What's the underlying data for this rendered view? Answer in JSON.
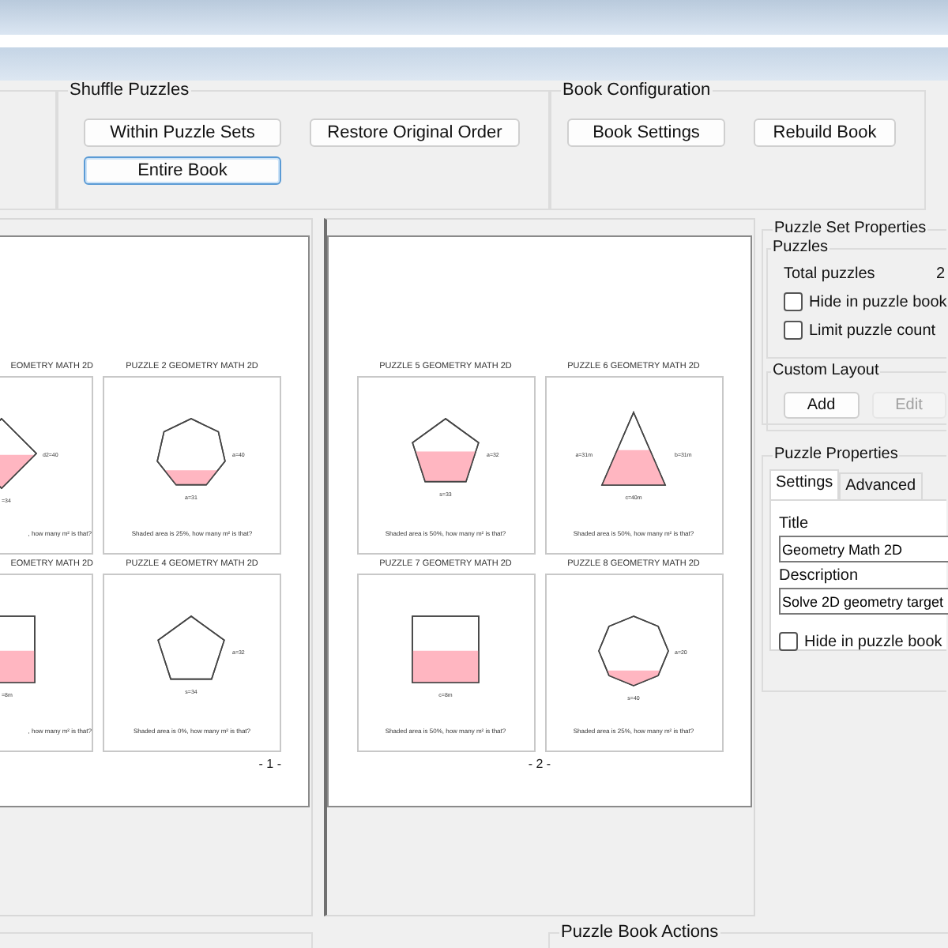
{
  "ribbon": {
    "groups": [
      {
        "title": "Shuffle Puzzles",
        "buttons": [
          {
            "label": "Within Puzzle Sets",
            "focused": false
          },
          {
            "label": "Restore Original Order",
            "focused": false
          },
          {
            "label": "Entire Book",
            "focused": true
          }
        ]
      },
      {
        "title": "Book Configuration",
        "buttons": [
          {
            "label": "Book Settings",
            "focused": false
          },
          {
            "label": "Rebuild Book",
            "focused": false
          }
        ]
      }
    ]
  },
  "pages": [
    {
      "number": "- 1 -",
      "cropped": true,
      "puzzles": [
        {
          "title": "EOMETRY MATH 2D",
          "kind": "diamond",
          "shading": {
            "kind": "half"
          },
          "labels": [
            {
              "text": "d2=40",
              "kind": "right"
            },
            {
              "text": "=34",
              "kind": "bottom"
            }
          ],
          "caption": ", how many m² is that?"
        },
        {
          "title": "PUZZLE 2 GEOMETRY MATH 2D",
          "kind": "heptagon",
          "shading": {
            "kind": "quarter"
          },
          "labels": [
            {
              "text": "a=40",
              "kind": "right"
            },
            {
              "text": "a=31",
              "kind": "bottom"
            }
          ],
          "caption": "Shaded area is 25%, how many m² is that?"
        },
        {
          "title": "EOMETRY MATH 2D",
          "kind": "square",
          "shading": {
            "kind": "half"
          },
          "labels": [
            {
              "text": "=8m",
              "kind": "bottom"
            }
          ],
          "caption": ", how many m² is that?"
        },
        {
          "title": "PUZZLE 4 GEOMETRY MATH 2D",
          "kind": "pentagon",
          "shading": {
            "kind": "none"
          },
          "labels": [
            {
              "text": "a=32",
              "kind": "right"
            },
            {
              "text": "s=34",
              "kind": "bottom"
            }
          ],
          "caption": "Shaded area is 0%, how many m² is that?"
        }
      ]
    },
    {
      "number": "- 2 -",
      "cropped": false,
      "puzzles": [
        {
          "title": "PUZZLE 5 GEOMETRY MATH 2D",
          "kind": "pentagon",
          "shading": {
            "kind": "half"
          },
          "labels": [
            {
              "text": "a=32",
              "kind": "right"
            },
            {
              "text": "s=33",
              "kind": "bottom"
            }
          ],
          "caption": "Shaded area is 50%, how many m² is that?"
        },
        {
          "title": "PUZZLE 6 GEOMETRY MATH 2D",
          "kind": "triangle",
          "shading": {
            "kind": "half"
          },
          "labels": [
            {
              "text": "a=31m",
              "kind": "left"
            },
            {
              "text": "b=31m",
              "kind": "right"
            },
            {
              "text": "c=40m",
              "kind": "bottom"
            }
          ],
          "caption": "Shaded area is 50%, how many m² is that?"
        },
        {
          "title": "PUZZLE 7 GEOMETRY MATH 2D",
          "kind": "square",
          "shading": {
            "kind": "half"
          },
          "labels": [
            {
              "text": "c=8m",
              "kind": "bottom"
            }
          ],
          "caption": "Shaded area is 50%, how many m² is that?"
        },
        {
          "title": "PUZZLE 8 GEOMETRY MATH 2D",
          "kind": "octagon",
          "shading": {
            "kind": "quarter"
          },
          "labels": [
            {
              "text": "a=20",
              "kind": "right"
            },
            {
              "text": "s=40",
              "kind": "bottom"
            }
          ],
          "caption": "Shaded area is 25%, how many m² is that?"
        }
      ]
    }
  ],
  "puzzle_set_properties": {
    "title": "Puzzle Set Properties",
    "puzzles": {
      "title": "Puzzles",
      "total_label": "Total puzzles",
      "total_value": "2",
      "checkboxes": [
        {
          "label": "Hide in puzzle book",
          "checked": false
        },
        {
          "label": "Limit puzzle count",
          "checked": false
        }
      ]
    },
    "custom_layout": {
      "title": "Custom Layout",
      "buttons": [
        {
          "label": "Add",
          "disabled": false
        },
        {
          "label": "Edit",
          "disabled": true
        }
      ]
    }
  },
  "puzzle_properties": {
    "title": "Puzzle Properties",
    "tabs": [
      {
        "label": "Settings",
        "selected": true
      },
      {
        "label": "Advanced",
        "selected": false
      }
    ],
    "fields": [
      {
        "label": "Title",
        "value": "Geometry Math 2D"
      },
      {
        "label": "Description",
        "value": "Solve 2D geometry target"
      }
    ],
    "checkbox": {
      "label": "Hide in puzzle book",
      "checked": false
    }
  },
  "bottom": {
    "title": "Puzzle Book Actions"
  }
}
